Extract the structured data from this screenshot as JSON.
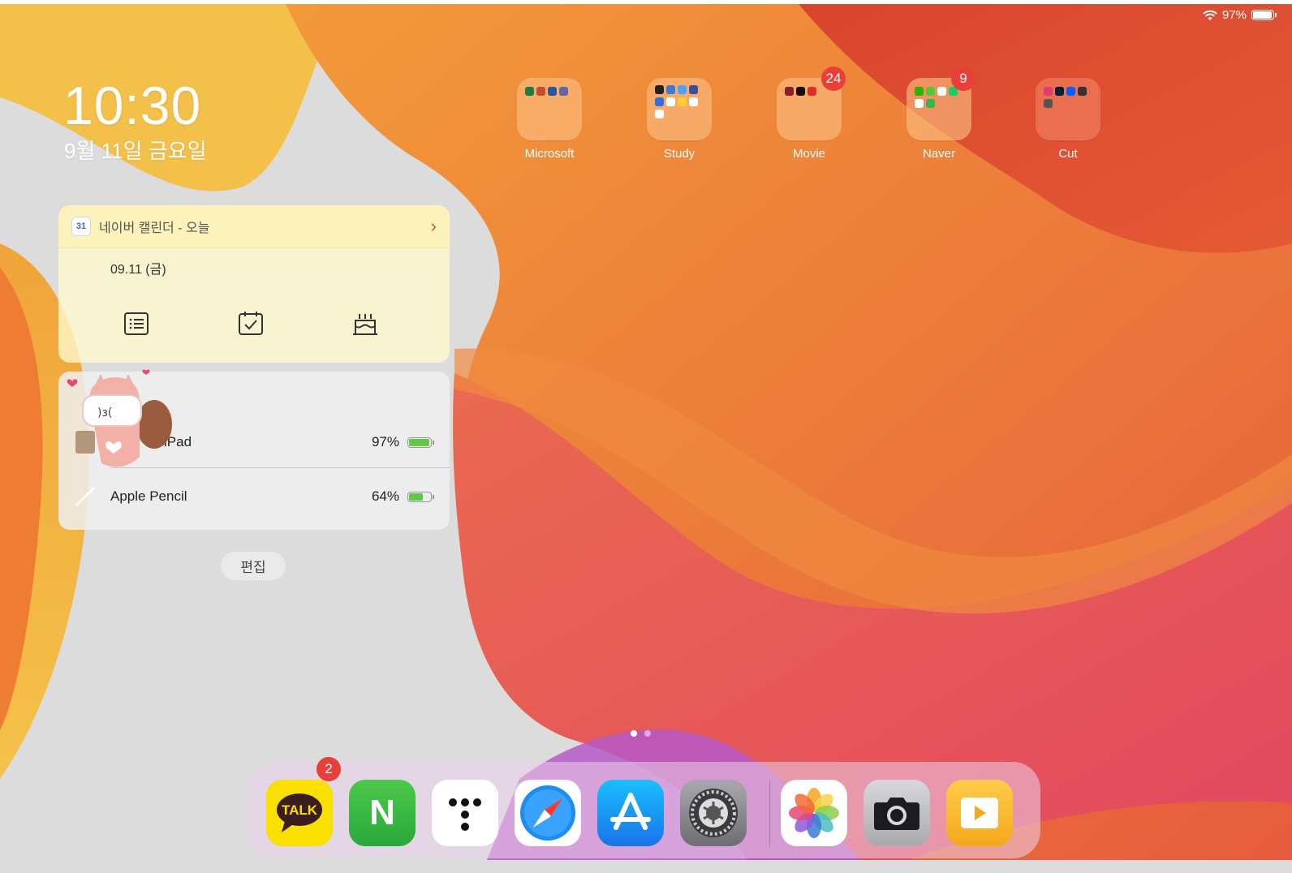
{
  "status_bar": {
    "battery_text": "97%",
    "battery_level": 0.97,
    "wifi_icon": "wifi-icon"
  },
  "clock": {
    "time": "10:30",
    "date": "9월 11일 금요일"
  },
  "folders": [
    {
      "label": "Microsoft",
      "badge": ""
    },
    {
      "label": "Study",
      "badge": ""
    },
    {
      "label": "Movie",
      "badge": "24"
    },
    {
      "label": "Naver",
      "badge": "9"
    },
    {
      "label": "Cut",
      "badge": ""
    }
  ],
  "calendar_widget": {
    "icon_text": "31",
    "title": "네이버 캘린더 - 오늘",
    "date": "09.11 (금)",
    "tools": [
      "list-icon",
      "checkbox-calendar-icon",
      "birthday-cake-icon"
    ]
  },
  "battery_widget": {
    "devices": [
      {
        "name": "iPad",
        "percent_text": "97%",
        "level": 0.97
      },
      {
        "name": "Apple Pencil",
        "percent_text": "64%",
        "level": 0.64
      }
    ]
  },
  "edit_button": {
    "label": "편집"
  },
  "page_dots": {
    "count": 2,
    "current": 1
  },
  "dock": {
    "apps": [
      {
        "name": "kakaotalk-app",
        "label": "TALK",
        "badge": "2",
        "color": "#f9e000"
      },
      {
        "name": "naver-app",
        "label": "N",
        "color": "#2db400"
      },
      {
        "name": "tmap-app",
        "color": "#ffffff"
      },
      {
        "name": "safari-app",
        "color": "#ffffff"
      },
      {
        "name": "app-store-app",
        "color": "#1a8cff"
      },
      {
        "name": "settings-app",
        "color": "#8e8e93"
      },
      {
        "name": "photos-app",
        "color": "#ffffff"
      },
      {
        "name": "camera-app",
        "color": "#c7c7cc"
      },
      {
        "name": "slides-app",
        "color": "#f4b400"
      }
    ]
  }
}
